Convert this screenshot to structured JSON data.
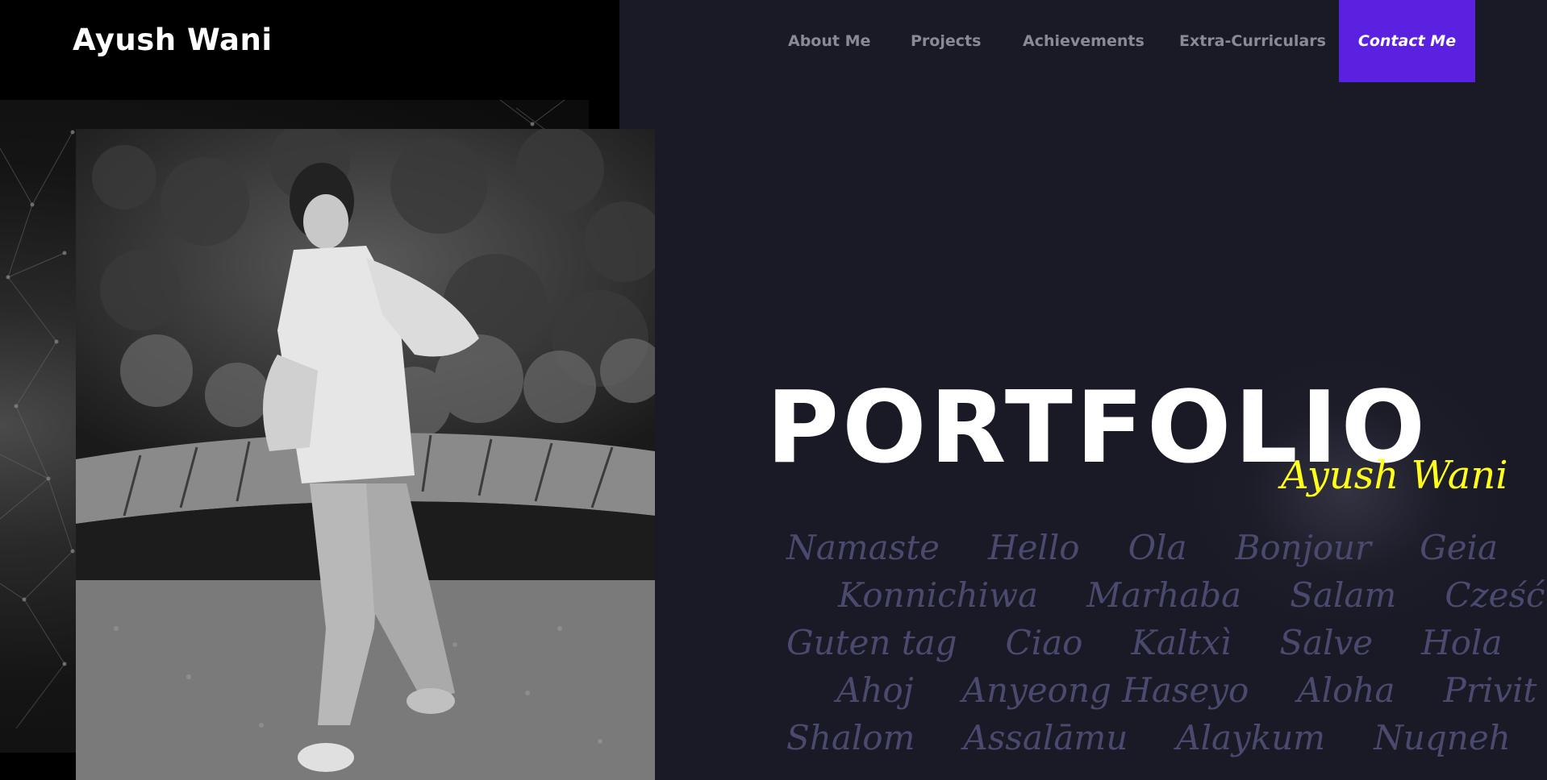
{
  "header": {
    "brand": "Ayush Wani",
    "nav": [
      {
        "label": "About Me"
      },
      {
        "label": "Projects"
      },
      {
        "label": "Achievements"
      },
      {
        "label": "Extra-Curriculars"
      }
    ],
    "contact_label": "Contact Me"
  },
  "hero": {
    "title": "PORTFOLIO",
    "signature": "Ayush Wani",
    "greetings": [
      [
        "Namaste",
        "Hello",
        "Ola",
        "Bonjour",
        "Geia"
      ],
      [
        "Konnichiwa",
        "Marhaba",
        "Salam",
        "Cześć"
      ],
      [
        "Guten tag",
        "Ciao",
        "Kaltxì",
        "Salve",
        "Hola"
      ],
      [
        "Ahoj",
        "Anyeong Haseyo",
        "Aloha",
        "Privit"
      ],
      [
        "Shalom",
        "Assalāmu",
        "Alaykum",
        "Nuqneh"
      ]
    ]
  },
  "colors": {
    "background": "#1a1a26",
    "accent": "#5b21e0",
    "signature": "#ffff1a",
    "greeting_text": "#4a4a6e"
  }
}
